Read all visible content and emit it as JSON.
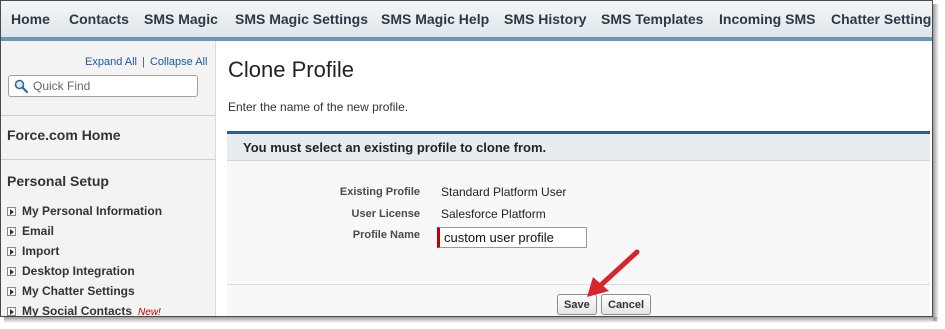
{
  "tabs": [
    {
      "label": "Home"
    },
    {
      "label": "Contacts"
    },
    {
      "label": "SMS Magic"
    },
    {
      "label": "SMS Magic Settings"
    },
    {
      "label": "SMS Magic Help"
    },
    {
      "label": "SMS History"
    },
    {
      "label": "SMS Templates"
    },
    {
      "label": "Incoming SMS"
    },
    {
      "label": "Chatter Settings"
    }
  ],
  "sidebar": {
    "expand_all": "Expand All",
    "separator": "|",
    "collapse_all": "Collapse All",
    "quick_find_placeholder": "Quick Find",
    "force_home": "Force.com Home",
    "personal_setup": "Personal Setup",
    "items": [
      {
        "label": "My Personal Information"
      },
      {
        "label": "Email"
      },
      {
        "label": "Import"
      },
      {
        "label": "Desktop Integration"
      },
      {
        "label": "My Chatter Settings"
      },
      {
        "label": "My Social Contacts",
        "badge": "New!"
      }
    ]
  },
  "main": {
    "title": "Clone Profile",
    "instruction": "Enter the name of the new profile.",
    "error_message": "You must select an existing profile to clone from.",
    "fields": {
      "existing_profile_label": "Existing Profile",
      "existing_profile_value": "Standard Platform User",
      "user_license_label": "User License",
      "user_license_value": "Salesforce Platform",
      "profile_name_label": "Profile Name",
      "profile_name_value": "custom user profile"
    },
    "buttons": {
      "save": "Save",
      "cancel": "Cancel"
    }
  },
  "colors": {
    "accent": "#2e5e8a",
    "tab_underline": "#6b97b1",
    "required": "#c00000",
    "annotation_arrow": "#d7262b"
  },
  "icons": [
    "search-icon",
    "expand-triangle-icon",
    "red-arrow-icon"
  ]
}
